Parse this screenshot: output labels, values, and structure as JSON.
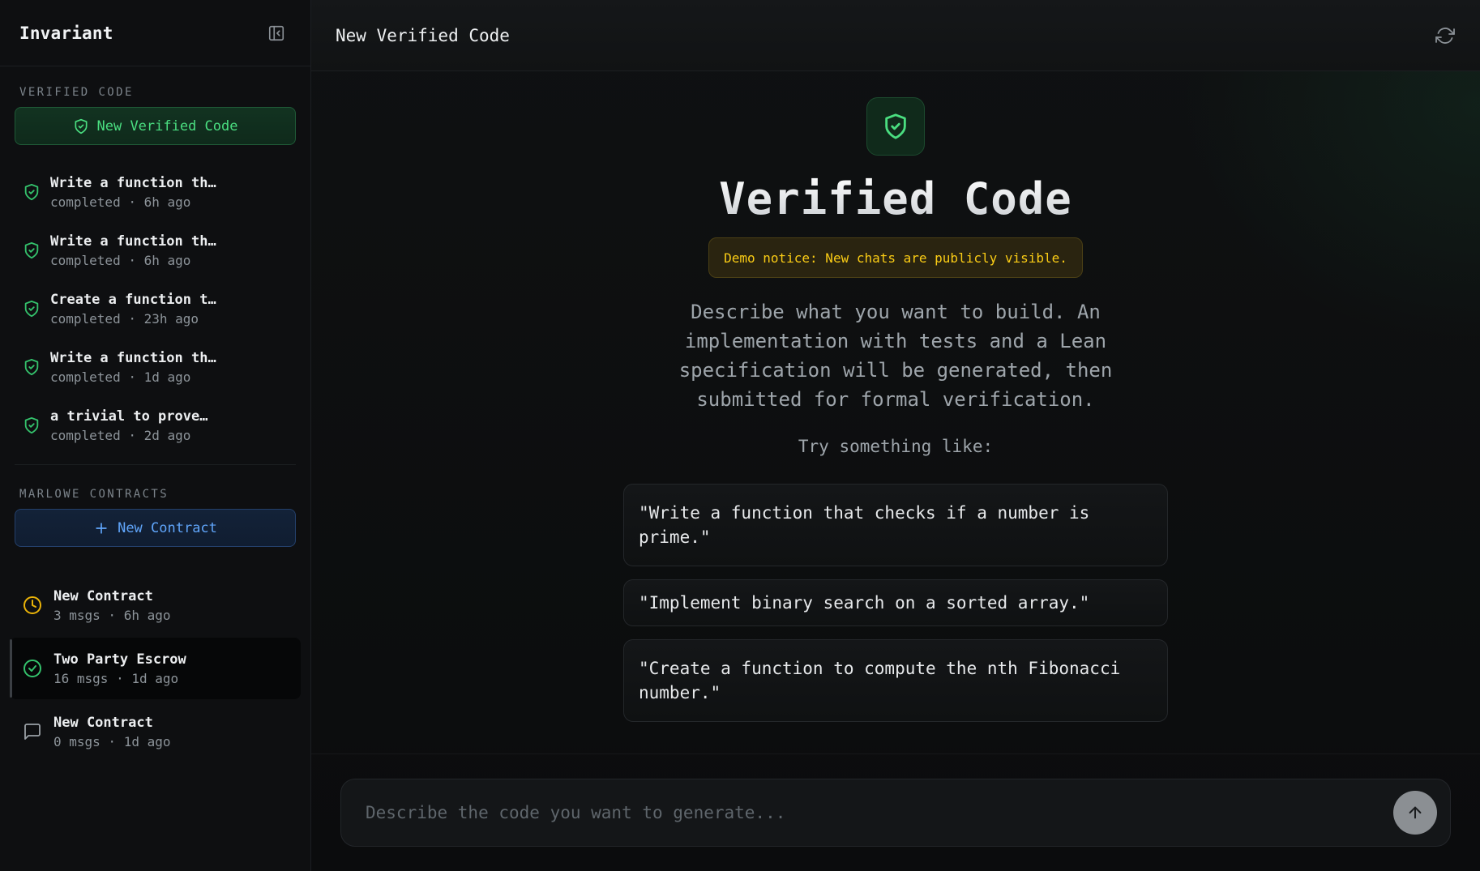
{
  "sidebar": {
    "brand": "Invariant",
    "verified_section_label": "VERIFIED CODE",
    "new_verified_label": "New Verified Code",
    "verified_items": [
      {
        "title": "Write a function th…",
        "meta": "completed · 6h ago"
      },
      {
        "title": "Write a function th…",
        "meta": "completed · 6h ago"
      },
      {
        "title": "Create a function t…",
        "meta": "completed · 23h ago"
      },
      {
        "title": "Write a function th…",
        "meta": "completed · 1d ago"
      },
      {
        "title": "a trivial to prove…",
        "meta": "completed · 2d ago"
      }
    ],
    "contracts_section_label": "MARLOWE CONTRACTS",
    "new_contract_label": "New Contract",
    "contracts": [
      {
        "title": "New Contract",
        "meta": "3 msgs · 6h ago",
        "status": "pending",
        "icon": "clock-icon"
      },
      {
        "title": "Two Party Escrow",
        "meta": "16 msgs · 1d ago",
        "status": "verified",
        "icon": "check-circle-icon",
        "active": true
      },
      {
        "title": "New Contract",
        "meta": "0 msgs · 1d ago",
        "status": "draft",
        "icon": "message-square-icon"
      }
    ]
  },
  "header": {
    "title": "New Verified Code"
  },
  "main": {
    "hero_title": "Verified Code",
    "notice": "Demo notice: New chats are publicly visible.",
    "description": "Describe what you want to build. An implementation with tests and a Lean specification will be generated, then submitted for formal verification.",
    "try_label": "Try something like:",
    "suggestions": [
      "\"Write a function that checks if a number is prime.\"",
      "\"Implement binary search on a sorted array.\"",
      "\"Create a function to compute the nth Fibonacci number.\""
    ]
  },
  "composer": {
    "placeholder": "Describe the code you want to generate...",
    "value": ""
  },
  "colors": {
    "accent_green": "#4ade80",
    "accent_blue": "#60a5fa",
    "warning_yellow": "#facc15",
    "background": "#0b0c0d"
  }
}
